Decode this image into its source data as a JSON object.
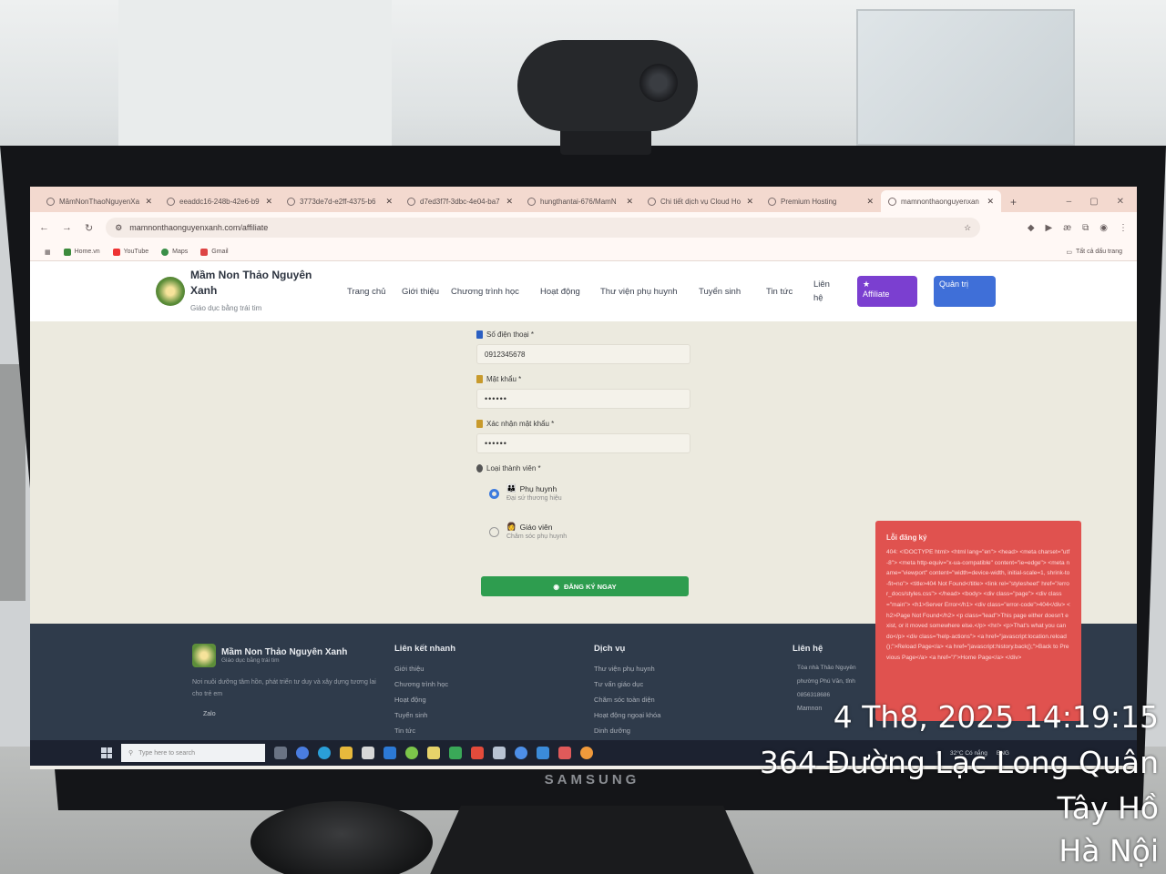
{
  "browser": {
    "tabs": [
      {
        "label": "MâmNonThaoNguyenXa"
      },
      {
        "label": "eeaddc16-248b-42e6-b9"
      },
      {
        "label": "3773de7d-e2ff-4375-b6"
      },
      {
        "label": "d7ed3f7f-3dbc-4e04-ba7"
      },
      {
        "label": "hungthantai-676/MamN"
      },
      {
        "label": "Chi tiết dịch vụ Cloud Ho"
      },
      {
        "label": "Premium Hosting"
      },
      {
        "label": "mamnonthaonguyenxan"
      }
    ],
    "url": "mamnonthaonguyenxanh.com/affiliate",
    "bookmarks": [
      "Home.vn",
      "YouTube",
      "Maps",
      "Gmail"
    ],
    "all_bookmarks": "Tất cả dấu trang"
  },
  "site": {
    "brand_name": "Mầm Non Thảo Nguyên Xanh",
    "brand_tagline": "Giáo dục bằng trái tim",
    "nav": [
      "Trang chủ",
      "Giới thiệu",
      "Chương trình học",
      "Hoạt động",
      "Thư viện phụ huynh",
      "Tuyển sinh",
      "Tin tức",
      "Liên hệ"
    ],
    "affiliate_label": "Affiliate",
    "admin_label": "Quản trị"
  },
  "form": {
    "phone_label": "Số điện thoại *",
    "phone_value": "0912345678",
    "password_label": "Mật khẩu *",
    "password_value": "••••••",
    "confirm_label": "Xác nhận mật khẩu *",
    "confirm_value": "••••••",
    "member_type_label": "Loại thành viên *",
    "options": [
      {
        "title": "Phụ huynh",
        "desc": "Đại sứ thương hiệu",
        "checked": true
      },
      {
        "title": "Giáo viên",
        "desc": "Chăm sóc phụ huynh",
        "checked": false
      }
    ],
    "submit_label": "ĐĂNG KÝ NGAY"
  },
  "error": {
    "title": "Lỗi đăng ký",
    "message": "404: <!DOCTYPE html> <html lang=\"en\"> <head> <meta charset=\"utf-8\"> <meta http-equiv=\"x-ua-compatible\" content=\"ie=edge\"> <meta name=\"viewport\" content=\"width=device-width, initial-scale=1, shrink-to-fit=no\"> <title>404 Not Found</title> <link rel=\"stylesheet\" href=\"/error_docs/styles.css\"> </head> <body> <div class=\"page\"> <div class=\"main\"> <h1>Server Error</h1> <div class=\"error-code\">404</div> <h2>Page Not Found</h2> <p class=\"lead\">This page either doesn't exist, or it moved somewhere else.</p> <hr/> <p>That's what you can do</p> <div class=\"help-actions\"> <a href=\"javascript:location.reload();\">Reload Page</a> <a href=\"javascript:history.back();\">Back to Previous Page</a> <a href=\"/\">Home Page</a> </div>"
  },
  "footer": {
    "brand_name": "Mầm Non Thảo Nguyên Xanh",
    "brand_tagline": "Giáo dục bằng trái tim",
    "description": "Nơi nuôi dưỡng tâm hồn, phát triển tư duy và xây dựng tương lai cho trẻ em",
    "zalo": "Zalo",
    "quick_links_title": "Liên kết nhanh",
    "quick_links": [
      "Giới thiệu",
      "Chương trình học",
      "Hoạt động",
      "Tuyển sinh",
      "Tin tức"
    ],
    "services_title": "Dịch vụ",
    "services": [
      "Thư viện phụ huynh",
      "Tư vấn giáo dục",
      "Chăm sóc toàn diện",
      "Hoạt động ngoại khóa",
      "Dinh dưỡng"
    ],
    "contact_title": "Liên hệ",
    "contact": [
      "Tòa nhà Thảo Nguyên",
      "phường Phú Văn, tỉnh",
      "0856318686",
      "Mamnon"
    ]
  },
  "taskbar": {
    "search_placeholder": "Type here to search",
    "weather": "32°C Có nắng",
    "lang": "ENG"
  },
  "stamp": {
    "datetime": "4 Th8, 2025 14:19:15",
    "address": "364 Đường Lạc Long Quân",
    "district": "Tây Hồ",
    "city": "Hà Nội"
  },
  "monitor_brand": "SAMSUNG"
}
